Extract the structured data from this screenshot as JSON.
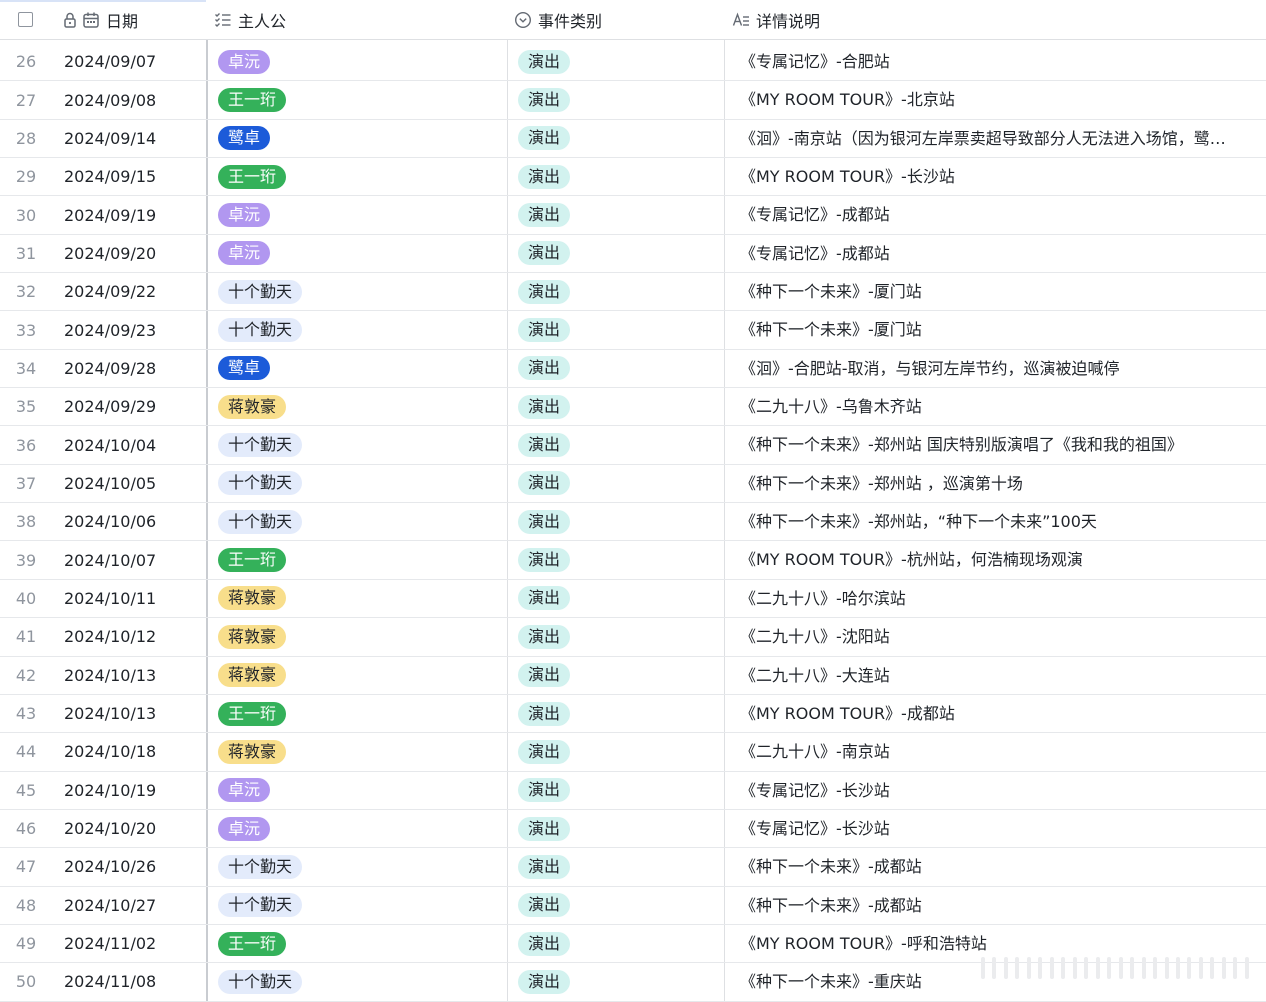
{
  "header": {
    "date": "日期",
    "host": "主人公",
    "type": "事件类别",
    "desc": "详情说明"
  },
  "colors": {
    "卓沅": "t-purple",
    "王一珩": "t-green",
    "鹭卓": "t-blue",
    "十个勤天": "t-lightblue",
    "蒋敦豪": "t-yellow"
  },
  "rows": [
    {
      "idx": "26",
      "date": "2024/09/07",
      "host": "卓沅",
      "type": "演出",
      "desc": "《专属记忆》-合肥站"
    },
    {
      "idx": "27",
      "date": "2024/09/08",
      "host": "王一珩",
      "type": "演出",
      "desc": "《MY ROOM TOUR》-北京站"
    },
    {
      "idx": "28",
      "date": "2024/09/14",
      "host": "鹭卓",
      "type": "演出",
      "desc": "《洄》-南京站（因为银河左岸票卖超导致部分人无法进入场馆，鹭…"
    },
    {
      "idx": "29",
      "date": "2024/09/15",
      "host": "王一珩",
      "type": "演出",
      "desc": "《MY ROOM TOUR》-长沙站"
    },
    {
      "idx": "30",
      "date": "2024/09/19",
      "host": "卓沅",
      "type": "演出",
      "desc": "《专属记忆》-成都站"
    },
    {
      "idx": "31",
      "date": "2024/09/20",
      "host": "卓沅",
      "type": "演出",
      "desc": "《专属记忆》-成都站"
    },
    {
      "idx": "32",
      "date": "2024/09/22",
      "host": "十个勤天",
      "type": "演出",
      "desc": "《种下一个未来》-厦门站"
    },
    {
      "idx": "33",
      "date": "2024/09/23",
      "host": "十个勤天",
      "type": "演出",
      "desc": "《种下一个未来》-厦门站"
    },
    {
      "idx": "34",
      "date": "2024/09/28",
      "host": "鹭卓",
      "type": "演出",
      "desc": "《洄》-合肥站-取消，与银河左岸节约，巡演被迫喊停"
    },
    {
      "idx": "35",
      "date": "2024/09/29",
      "host": "蒋敦豪",
      "type": "演出",
      "desc": "《二九十八》-乌鲁木齐站"
    },
    {
      "idx": "36",
      "date": "2024/10/04",
      "host": "十个勤天",
      "type": "演出",
      "desc": "《种下一个未来》-郑州站 国庆特别版演唱了《我和我的祖国》"
    },
    {
      "idx": "37",
      "date": "2024/10/05",
      "host": "十个勤天",
      "type": "演出",
      "desc": "《种下一个未来》-郑州站 ，巡演第十场"
    },
    {
      "idx": "38",
      "date": "2024/10/06",
      "host": "十个勤天",
      "type": "演出",
      "desc": "《种下一个未来》-郑州站，“种下一个未来”100天"
    },
    {
      "idx": "39",
      "date": "2024/10/07",
      "host": "王一珩",
      "type": "演出",
      "desc": "《MY ROOM TOUR》-杭州站，何浩楠现场观演"
    },
    {
      "idx": "40",
      "date": "2024/10/11",
      "host": "蒋敦豪",
      "type": "演出",
      "desc": "《二九十八》-哈尔滨站"
    },
    {
      "idx": "41",
      "date": "2024/10/12",
      "host": "蒋敦豪",
      "type": "演出",
      "desc": "《二九十八》-沈阳站"
    },
    {
      "idx": "42",
      "date": "2024/10/13",
      "host": "蒋敦豪",
      "type": "演出",
      "desc": "《二九十八》-大连站"
    },
    {
      "idx": "43",
      "date": "2024/10/13",
      "host": "王一珩",
      "type": "演出",
      "desc": "《MY ROOM TOUR》-成都站"
    },
    {
      "idx": "44",
      "date": "2024/10/18",
      "host": "蒋敦豪",
      "type": "演出",
      "desc": "《二九十八》-南京站"
    },
    {
      "idx": "45",
      "date": "2024/10/19",
      "host": "卓沅",
      "type": "演出",
      "desc": "《专属记忆》-长沙站"
    },
    {
      "idx": "46",
      "date": "2024/10/20",
      "host": "卓沅",
      "type": "演出",
      "desc": "《专属记忆》-长沙站"
    },
    {
      "idx": "47",
      "date": "2024/10/26",
      "host": "十个勤天",
      "type": "演出",
      "desc": "《种下一个未来》-成都站"
    },
    {
      "idx": "48",
      "date": "2024/10/27",
      "host": "十个勤天",
      "type": "演出",
      "desc": "《种下一个未来》-成都站"
    },
    {
      "idx": "49",
      "date": "2024/11/02",
      "host": "王一珩",
      "type": "演出",
      "desc": "《MY ROOM TOUR》-呼和浩特站"
    },
    {
      "idx": "50",
      "date": "2024/11/08",
      "host": "十个勤天",
      "type": "演出",
      "desc": "《种下一个未来》-重庆站"
    }
  ]
}
